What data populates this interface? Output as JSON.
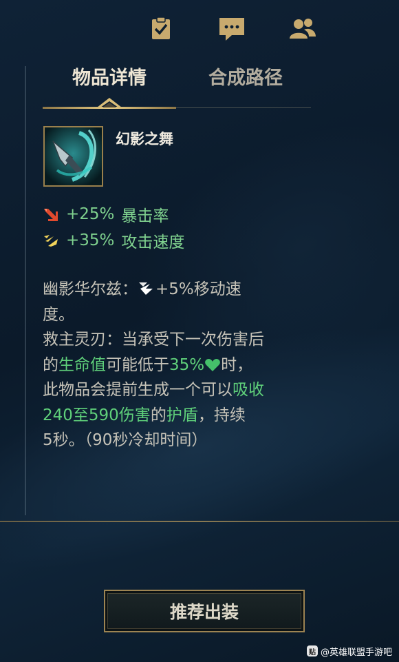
{
  "topbar": {
    "icons": [
      "checklist-icon",
      "chat-icon",
      "friends-icon"
    ]
  },
  "tabs": [
    {
      "label": "物品详情",
      "active": true
    },
    {
      "label": "合成路径",
      "active": false
    }
  ],
  "item": {
    "name": "幻影之舞",
    "stats": [
      {
        "icon": "crit-icon",
        "value": "+25%",
        "label": "暴击率"
      },
      {
        "icon": "attack-speed-icon",
        "value": "+35%",
        "label": "攻击速度"
      }
    ]
  },
  "passive1": {
    "name": "幽影华尔兹：",
    "effect_a": "+5%移动速",
    "effect_b": "度。"
  },
  "passive2": {
    "line1": "救主灵刃：当承受下一次伤害后",
    "p_a": "的",
    "p_b": "生命值",
    "p_c": "可能低于",
    "p_d": "35%",
    "p_e": "时，",
    "q_a": "此物品会提前生成一个可以",
    "q_b": "吸收",
    "r_a": "240至590伤害",
    "r_b": "的",
    "r_c": "护盾",
    "r_d": "，持续",
    "line_end": "5秒。（90秒冷却时间）"
  },
  "recommend_button": "推荐出装",
  "watermark": {
    "logo": "贴",
    "text": "@英雄联盟手游吧"
  },
  "colors": {
    "gold": "#c8aa6e",
    "green": "#5fd07a",
    "text": "#c6c3b8"
  }
}
